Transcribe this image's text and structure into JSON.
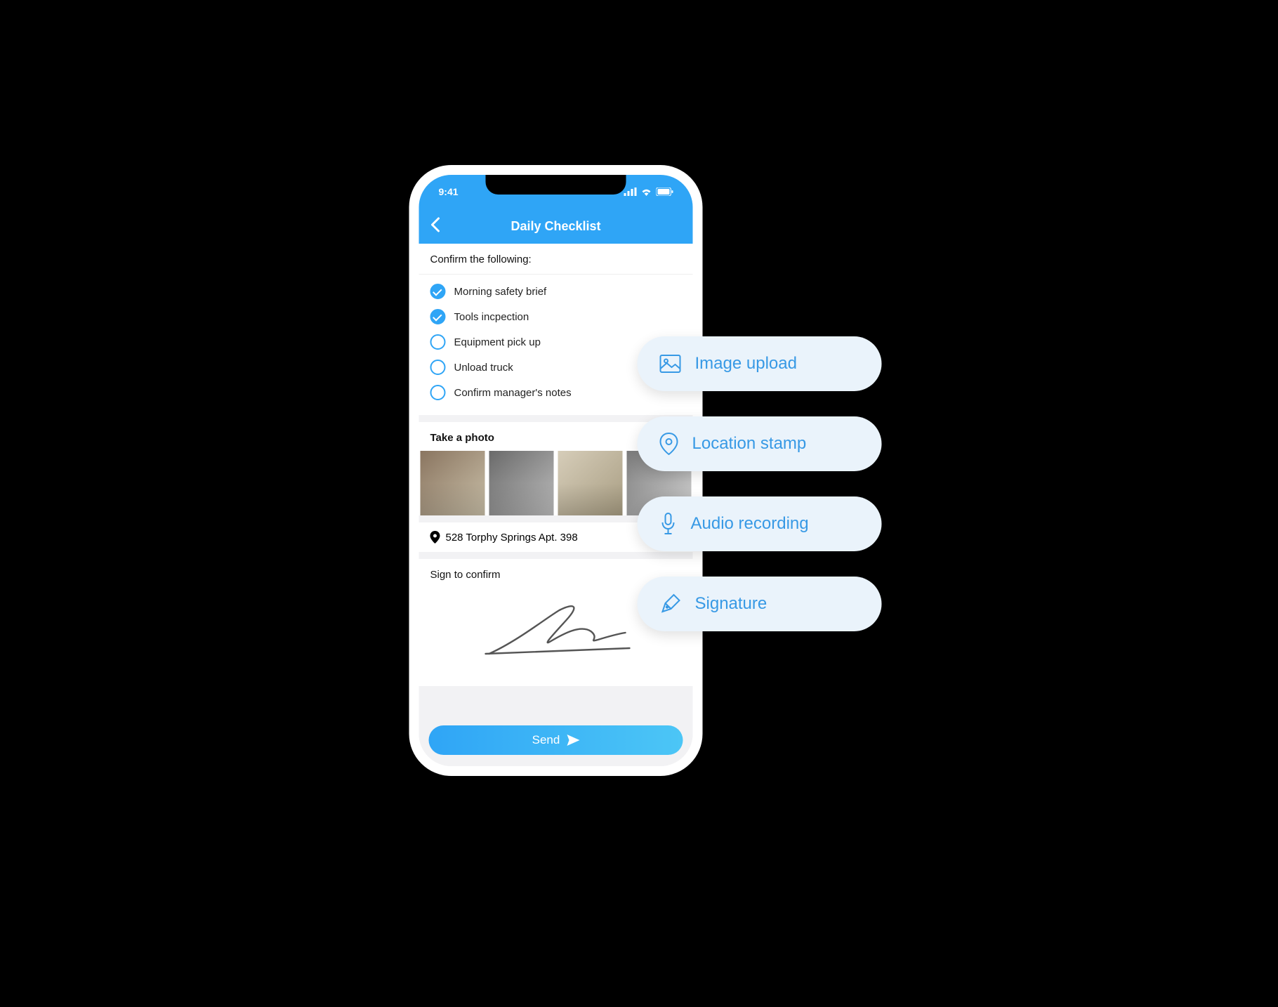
{
  "statusbar": {
    "time": "9:41"
  },
  "navbar": {
    "title": "Daily Checklist"
  },
  "confirm": {
    "heading": "Confirm the following:",
    "items": [
      {
        "label": "Morning safety brief",
        "checked": true
      },
      {
        "label": "Tools incpection",
        "checked": true
      },
      {
        "label": "Equipment pick up",
        "checked": false
      },
      {
        "label": "Unload truck",
        "checked": false
      },
      {
        "label": "Confirm manager's notes",
        "checked": false
      }
    ]
  },
  "photo": {
    "heading": "Take a photo"
  },
  "location": {
    "address": "528 Torphy Springs Apt. 398"
  },
  "sign": {
    "heading": "Sign to confirm"
  },
  "send": {
    "label": "Send"
  },
  "pills": [
    {
      "label": "Image upload"
    },
    {
      "label": "Location stamp"
    },
    {
      "label": "Audio recording"
    },
    {
      "label": "Signature"
    }
  ],
  "colors": {
    "accent": "#2fa5f6",
    "pill_bg": "#eaf3fb",
    "pill_text": "#3799e5"
  }
}
